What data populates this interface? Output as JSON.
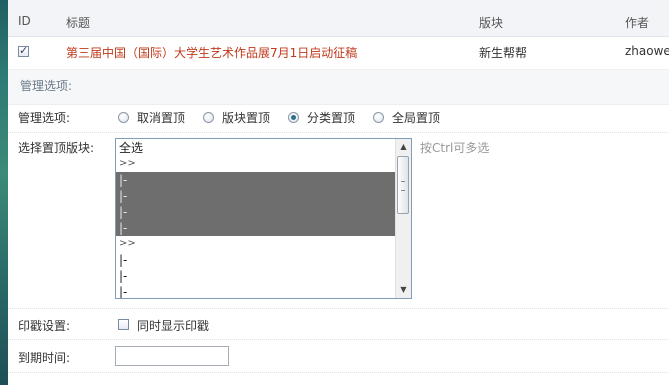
{
  "table": {
    "headers": {
      "id": "ID",
      "title": "标题",
      "board": "版块",
      "author": "作者"
    },
    "row": {
      "checked": true,
      "title": "第三届中国（国际）大学生艺术作品展7月1日启动征稿",
      "board": "新生帮帮",
      "author": "zhaowe"
    }
  },
  "section": {
    "title": "管理选项:"
  },
  "form": {
    "manage_label": "管理选项:",
    "radios": [
      {
        "label": "取消置顶",
        "checked": false
      },
      {
        "label": "版块置顶",
        "checked": false
      },
      {
        "label": "分类置顶",
        "checked": true
      },
      {
        "label": "全局置顶",
        "checked": false
      }
    ],
    "board_select_label": "选择置顶版块:",
    "board_options": [
      {
        "text": "全选",
        "selected": false
      },
      {
        "text": ">>",
        "selected": false
      },
      {
        "text": "|-",
        "selected": true
      },
      {
        "text": "|-",
        "selected": true
      },
      {
        "text": "|-",
        "selected": true
      },
      {
        "text": "|-",
        "selected": true
      },
      {
        "text": ">>",
        "selected": false
      },
      {
        "text": "|-",
        "selected": false
      },
      {
        "text": "|-",
        "selected": false
      },
      {
        "text": "|-",
        "selected": false
      }
    ],
    "board_hint": "按Ctrl可多选",
    "stamp_label": "印戳设置:",
    "stamp_checkbox_label": "同时显示印戳",
    "stamp_checked": false,
    "expire_label": "到期时间:",
    "expire_value": ""
  },
  "colors": {
    "title_link": "#c0391b",
    "selected_option_bg": "#6e6e6e"
  }
}
